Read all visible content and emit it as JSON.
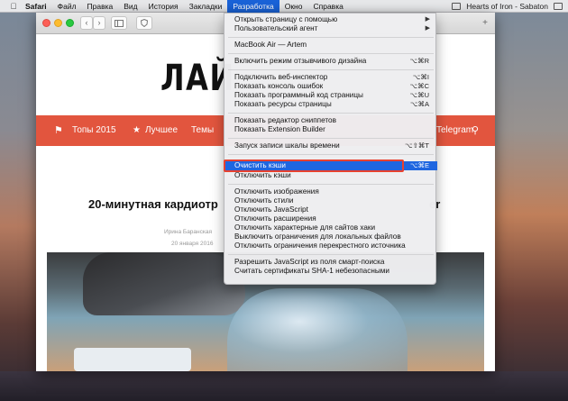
{
  "menubar": {
    "app": "Safari",
    "items": [
      "Файл",
      "Правка",
      "Вид",
      "История",
      "Закладки",
      "Разработка",
      "Окно",
      "Справка"
    ],
    "active": "Разработка",
    "right_text": "Hearts of Iron - Sabaton"
  },
  "browser": {
    "back_icon": "‹",
    "forward_icon": "›",
    "plus_icon": "+"
  },
  "page": {
    "logo": "ЛАЙ",
    "nav": {
      "item1": "Топы 2015",
      "item2": "Лучшее",
      "item3": "Темы",
      "item4": "Telegram"
    },
    "article_title_start": "20-минутная кардиотр",
    "article_title_end": "er",
    "author": "Ирина Баранская",
    "date": "20 января 2016"
  },
  "dev_menu": {
    "items": [
      {
        "label": "Открыть страницу с помощью",
        "submenu": true
      },
      {
        "label": "Пользовательский агент",
        "submenu": true
      },
      {
        "label": "MacBook Air — Artem"
      },
      {
        "label": "Включить режим отзывчивого дизайна",
        "shortcut": "⌥⌘R"
      },
      {
        "label": "Подключить веб-инспектор",
        "shortcut": "⌥⌘I"
      },
      {
        "label": "Показать консоль ошибок",
        "shortcut": "⌥⌘C"
      },
      {
        "label": "Показать программный код страницы",
        "shortcut": "⌥⌘U"
      },
      {
        "label": "Показать ресурсы страницы",
        "shortcut": "⌥⌘A"
      },
      {
        "label": "Показать редактор сниппетов"
      },
      {
        "label": "Показать Extension Builder"
      },
      {
        "label": "Запуск записи шкалы времени",
        "shortcut": "⌥⇧⌘T"
      },
      {
        "label": "Очистить кэши",
        "shortcut": "⌥⌘E",
        "highlighted": true
      },
      {
        "label": "Отключить кэши"
      },
      {
        "label": "Отключить изображения"
      },
      {
        "label": "Отключить стили"
      },
      {
        "label": "Отключить JavaScript"
      },
      {
        "label": "Отключить расширения"
      },
      {
        "label": "Отключить характерные для сайтов хаки"
      },
      {
        "label": "Выключить ограничения для локальных файлов"
      },
      {
        "label": "Отключить ограничения перекрестного источника"
      },
      {
        "label": "Разрешить JavaScript из поля смарт-поиска"
      },
      {
        "label": "Считать сертификаты SHA-1 небезопасными"
      }
    ]
  },
  "colors": {
    "nav_bg": "#e2553e",
    "highlight": "#1f66e0",
    "annotation": "#e8412f"
  }
}
